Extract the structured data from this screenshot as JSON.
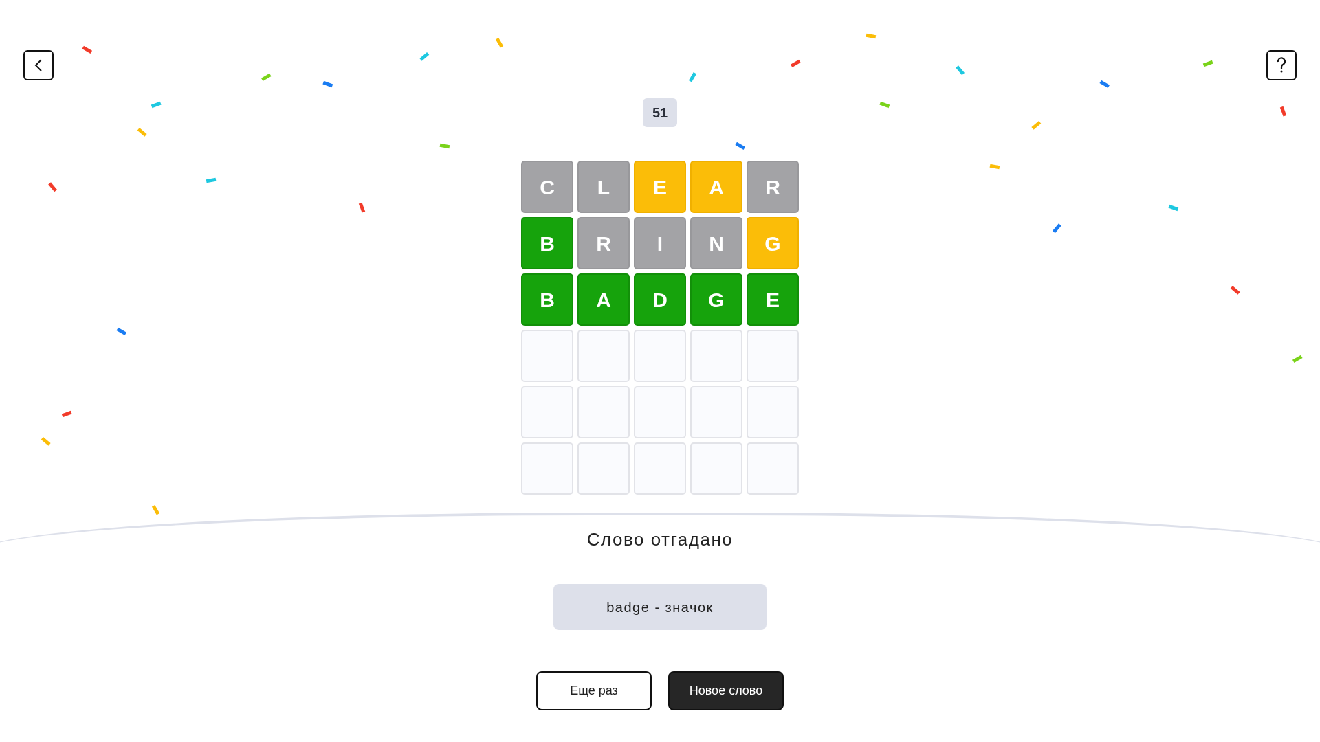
{
  "header": {
    "round": "51"
  },
  "board": [
    {
      "tiles": [
        {
          "letter": "C",
          "kind": "absent"
        },
        {
          "letter": "L",
          "kind": "absent"
        },
        {
          "letter": "E",
          "kind": "present"
        },
        {
          "letter": "A",
          "kind": "present"
        },
        {
          "letter": "R",
          "kind": "absent"
        }
      ]
    },
    {
      "tiles": [
        {
          "letter": "B",
          "kind": "correct"
        },
        {
          "letter": "R",
          "kind": "absent"
        },
        {
          "letter": "I",
          "kind": "absent"
        },
        {
          "letter": "N",
          "kind": "absent"
        },
        {
          "letter": "G",
          "kind": "present"
        }
      ]
    },
    {
      "tiles": [
        {
          "letter": "B",
          "kind": "correct"
        },
        {
          "letter": "A",
          "kind": "correct"
        },
        {
          "letter": "D",
          "kind": "correct"
        },
        {
          "letter": "G",
          "kind": "correct"
        },
        {
          "letter": "E",
          "kind": "correct"
        }
      ]
    },
    {
      "tiles": [
        {
          "kind": "empty"
        },
        {
          "kind": "empty"
        },
        {
          "kind": "empty"
        },
        {
          "kind": "empty"
        },
        {
          "kind": "empty"
        }
      ]
    },
    {
      "tiles": [
        {
          "kind": "empty"
        },
        {
          "kind": "empty"
        },
        {
          "kind": "empty"
        },
        {
          "kind": "empty"
        },
        {
          "kind": "empty"
        }
      ]
    },
    {
      "tiles": [
        {
          "kind": "empty"
        },
        {
          "kind": "empty"
        },
        {
          "kind": "empty"
        },
        {
          "kind": "empty"
        },
        {
          "kind": "empty"
        }
      ]
    }
  ],
  "result": {
    "title": "Слово отгадано",
    "translation": "badge - значок",
    "buttons": [
      {
        "label": "Еще раз",
        "kind": "outline"
      },
      {
        "label": "Новое слово",
        "kind": "filled"
      }
    ]
  }
}
